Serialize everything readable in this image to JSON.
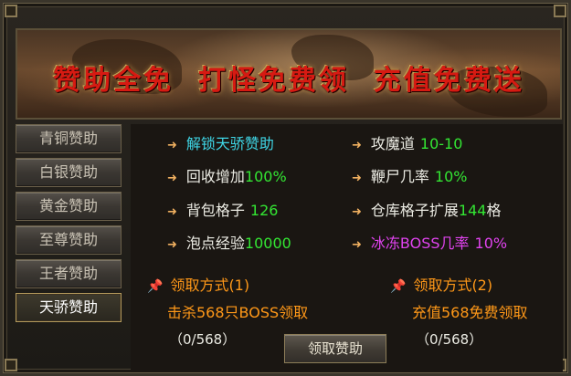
{
  "banner": {
    "text": "赞助全免  打怪免费领  充值免费送"
  },
  "sidebar": {
    "items": [
      {
        "label": "青铜赞助"
      },
      {
        "label": "白银赞助"
      },
      {
        "label": "黄金赞助"
      },
      {
        "label": "至尊赞助"
      },
      {
        "label": "王者赞助"
      },
      {
        "label": "天骄赞助",
        "active": true
      }
    ]
  },
  "benefits": {
    "left": [
      {
        "label": "解锁天骄赞助",
        "value": ""
      },
      {
        "label": "回收增加",
        "value": "100%"
      },
      {
        "label": "背包格子",
        "value": "126"
      },
      {
        "label": "泡点经验",
        "value": "10000"
      }
    ],
    "right": [
      {
        "label": "攻魔道",
        "value": "10-10"
      },
      {
        "label": "鞭尸几率",
        "value": "10%"
      },
      {
        "label": "仓库格子扩展",
        "value": "144",
        "suffix": "格"
      },
      {
        "label": "冰冻BOSS几率",
        "value": "10%"
      }
    ]
  },
  "methods": [
    {
      "title": "领取方式(1)",
      "desc": "击杀568只BOSS领取",
      "progress": "（0/568）"
    },
    {
      "title": "领取方式(2)",
      "desc": "充值568免费领取",
      "progress": "（0/568）"
    }
  ],
  "claim_button": {
    "label": "领取赞助"
  },
  "colors": {
    "value_green": "#33e633",
    "highlight_cyan": "#3fd6e6",
    "highlight_magenta": "#e043ef",
    "orange": "#ff9818",
    "banner_red": "#d61a12"
  }
}
